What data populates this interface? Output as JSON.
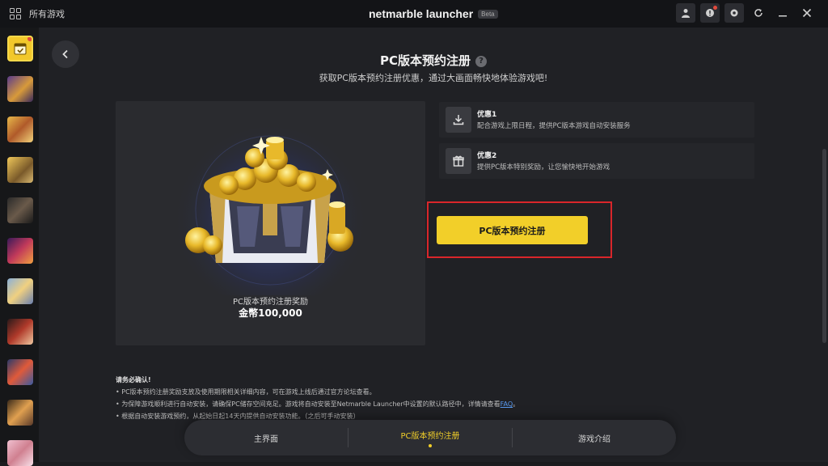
{
  "titlebar": {
    "all_games_label": "所有游戏",
    "brand": "netmarble launcher",
    "beta_badge": "Beta"
  },
  "page": {
    "title": "PC版本预约注册",
    "subtitle": "获取PC版本预约注册优惠，通过大画面畅快地体验游戏吧!"
  },
  "reward": {
    "caption": "PC版本预约注册奖励",
    "amount": "金幣100,000"
  },
  "benefits": [
    {
      "title": "优惠1",
      "desc": "配合游戏上限日程，提供PC版本游戏自动安装服务",
      "icon": "download-icon"
    },
    {
      "title": "优惠2",
      "desc": "提供PC版本特别奖励，让您愉快地开始游戏",
      "icon": "gift-icon"
    }
  ],
  "register_button": "PC版本预约注册",
  "notice": {
    "title": "请务必确认!",
    "line1": "• PC版本预约注册奖励支放及使用期限相关详细内容，可在游戏上线后通过官方论坛查看。",
    "line2_prefix": "• 为保障游戏顺利进行自动安装，请确保PC储存空间充足。游戏将自动安装至Netmarble Launcher中设置的默认路径中，详情请查看",
    "line2_link": "FAQ",
    "line2_suffix": "。",
    "line3": "• 根据自动安装游戏预约，从起始日起14天内提供自动安装功能。（之后可手动安装）"
  },
  "bottom_nav": {
    "home": "主界面",
    "register": "PC版本预约注册",
    "intro": "游戏介绍"
  },
  "colors": {
    "accent": "#f2cf29",
    "highlight": "#d9262b",
    "link": "#5a9cf2"
  }
}
